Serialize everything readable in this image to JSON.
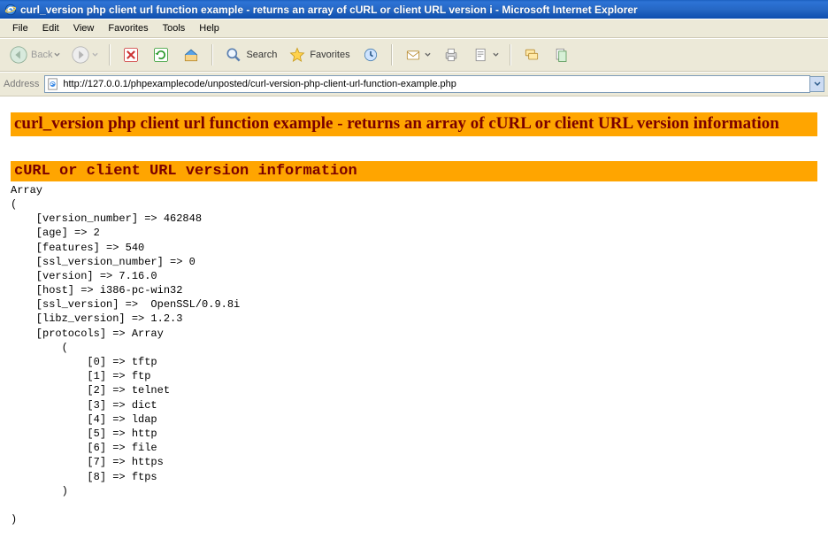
{
  "window": {
    "title": "curl_version php client url function example - returns an array of cURL or client URL version i - Microsoft Internet Explorer"
  },
  "menu": {
    "items": [
      "File",
      "Edit",
      "View",
      "Favorites",
      "Tools",
      "Help"
    ]
  },
  "toolbar": {
    "back_label": "Back",
    "search_label": "Search",
    "favorites_label": "Favorites"
  },
  "address": {
    "label": "Address",
    "url": "http://127.0.0.1/phpexamplecode/unposted/curl-version-php-client-url-function-example.php"
  },
  "page": {
    "heading1": "curl_version php client url function example - returns an array of cURL or client URL version information",
    "heading2": "cURL or client URL version information"
  },
  "curl_version": {
    "version_number": 462848,
    "age": 2,
    "features": 540,
    "ssl_version_number": 0,
    "version": "7.16.0",
    "host": "i386-pc-win32",
    "ssl_version": " OpenSSL/0.9.8i",
    "libz_version": "1.2.3",
    "protocols": [
      "tftp",
      "ftp",
      "telnet",
      "dict",
      "ldap",
      "http",
      "file",
      "https",
      "ftps"
    ]
  }
}
